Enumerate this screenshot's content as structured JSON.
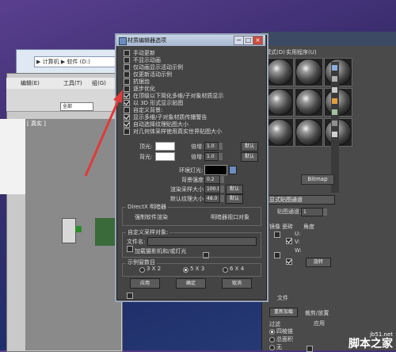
{
  "explorer": {
    "address": "▶ 计算机 ▶ 软件 (D:)"
  },
  "mainapp": {
    "menu": [
      "编辑(E)",
      "工具(T)",
      "组(G)"
    ],
    "layer_dropdown": "全部",
    "viewport_label": "[ 真实 ]"
  },
  "material_editor": {
    "menu": [
      "模式(D)",
      "实用程序(U)"
    ],
    "map_button": "Bitmap",
    "labels": {
      "type_dropdown": "显式贴图通道",
      "channel_label": "贴图通道：",
      "channel_value": "1",
      "mirror": "镜像",
      "tile": "瓷砖",
      "angle": "角度",
      "u": "U:",
      "v": "V:",
      "w": "W:",
      "rotate": "旋转",
      "reload": "重新加载",
      "crop": "裁剪/放置",
      "apply": "应用",
      "view_image": "查看",
      "filter": "过滤",
      "filter_four": "四棱锥",
      "filter_sum": "总面积",
      "filter_none": "无",
      "file_label": "文件"
    }
  },
  "dialog": {
    "title": "材质编辑器选项",
    "checkboxes": [
      {
        "label": "手动更新",
        "checked": false
      },
      {
        "label": "不显示动画",
        "checked": false
      },
      {
        "label": "仅动画显示活动示例",
        "checked": false
      },
      {
        "label": "仅更新活动示例",
        "checked": false
      },
      {
        "label": "抗锯齿",
        "checked": false
      },
      {
        "label": "逐步优化",
        "checked": false
      },
      {
        "label": "在顶级以下简化多维/子对象材质显示",
        "checked": true
      },
      {
        "label": "以 3D 形式显示贴图",
        "checked": true
      },
      {
        "label": "自定义背景:",
        "checked": false
      },
      {
        "label": "显示多维/子对象材质传播警告",
        "checked": true
      },
      {
        "label": "自动选择纹理贴图大小",
        "checked": true
      },
      {
        "label": "对几何体采样使用真实世界贴图大小",
        "checked": false
      }
    ],
    "lighting": {
      "top_light": "顶光:",
      "back_light": "背光:",
      "multiplier": "倍增:",
      "top_value": "1.0",
      "back_value": "1.0",
      "default": "默认"
    },
    "ambient": {
      "ambient_label": "环境灯光:",
      "bg_intensity": "背景强度:",
      "bg_value": "0.2",
      "render_size": "渲染采样大小:",
      "render_value": "100.0",
      "default_tex": "默认纹理大小:",
      "tex_value": "48.0",
      "default": "默认"
    },
    "directx": {
      "title": "DirectX 明暗器",
      "force_software": "强制软件渲染",
      "compare_vp": "明暗器视口对象"
    },
    "custom_sample": {
      "title": "自定义采样对象:",
      "file_label": "文件名:",
      "load_camera": "加载摄影机和/或灯光"
    },
    "slots": {
      "title": "示例窗数目",
      "options": [
        "3 X 2",
        "5 X 3",
        "6 X 4"
      ],
      "selected": 1
    },
    "buttons": {
      "apply": "应用",
      "ok": "确定",
      "cancel": "取消"
    }
  },
  "watermark": {
    "site": "jb51.net",
    "name": "脚本之家"
  },
  "colors": {
    "dialog_bg": "#444444",
    "arrow": "#e03a3a",
    "title_bar": "#b8c6dc"
  }
}
